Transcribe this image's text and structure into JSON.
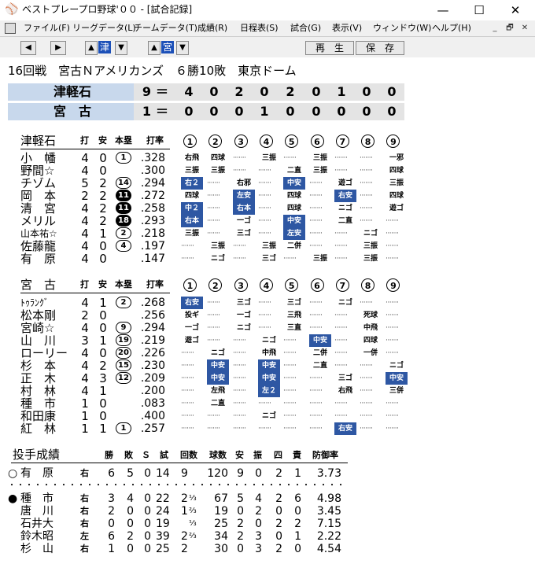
{
  "window": {
    "title": "ベストプレープロ野球'００ - [試合記録]",
    "controls": [
      "—",
      "☐",
      "✕"
    ]
  },
  "menu": {
    "items": [
      "ファイル(F)",
      "リーグデータ(L)",
      "チームデータ(T)",
      "成績(R)",
      "日程表(S)",
      "試合(G)",
      "表示(V)",
      "ウィンドウ(W)",
      "ヘルプ(H)"
    ],
    "mdi": [
      "_",
      "🗗",
      "✕"
    ]
  },
  "toolbar": {
    "left_arrow": "◀",
    "right_arrow": "▶",
    "team1": "津",
    "team2": "宮",
    "up": "▲",
    "down": "▼",
    "play_label": "再　生",
    "save_label": "保　存"
  },
  "game_info": "16回戦　宮古Ｎアメリカンズ　６勝10敗　東京ドーム",
  "scoreboard": [
    {
      "team": "津軽石",
      "total": "9",
      "eq": "＝",
      "innings": [
        "4",
        "0",
        "2",
        "0",
        "2",
        "0",
        "1",
        "0",
        "0"
      ]
    },
    {
      "team": "宮　古",
      "total": "1",
      "eq": "＝",
      "innings": [
        "0",
        "0",
        "0",
        "1",
        "0",
        "0",
        "0",
        "0",
        "0"
      ]
    }
  ],
  "batting_headers": {
    "ab": "打",
    "h": "安",
    "hr": "本塁",
    "avg": "打率",
    "innings": [
      "1",
      "2",
      "3",
      "4",
      "5",
      "6",
      "7",
      "8",
      "9"
    ]
  },
  "team1": {
    "name": "津軽石",
    "players": [
      {
        "name": "小　幡",
        "ab": "4",
        "h": "0",
        "hr": "1",
        "hr_filled": false,
        "avg": ".328",
        "cells": [
          {
            "t": "右飛"
          },
          {
            "t": "四球"
          },
          {
            "d": true
          },
          {
            "t": "三振"
          },
          {
            "d": true
          },
          {
            "t": "三振"
          },
          {
            "d": true
          },
          {
            "d": true
          },
          {
            "t": "一邪"
          }
        ]
      },
      {
        "name": "野間☆",
        "ab": "4",
        "h": "0",
        "hr": "",
        "hr_filled": false,
        "avg": ".300",
        "cells": [
          {
            "t": "三振"
          },
          {
            "t": "三振"
          },
          {
            "d": true
          },
          {
            "d": true
          },
          {
            "t": "二直"
          },
          {
            "t": "三振"
          },
          {
            "d": true
          },
          {
            "d": true
          },
          {
            "t": "四球"
          }
        ]
      },
      {
        "name": "チゾム",
        "ab": "5",
        "h": "2",
        "hr": "14",
        "hr_filled": false,
        "avg": ".294",
        "cells": [
          {
            "t": "右２",
            "hl": true
          },
          {
            "d": true
          },
          {
            "t": "右邪"
          },
          {
            "d": true
          },
          {
            "t": "中安",
            "hl": true
          },
          {
            "d": true
          },
          {
            "t": "遊ゴ"
          },
          {
            "d": true
          },
          {
            "t": "三振"
          }
        ]
      },
      {
        "name": "岡　本",
        "ab": "2",
        "h": "2",
        "hr": "11",
        "hr_filled": true,
        "avg": ".272",
        "cells": [
          {
            "t": "四球"
          },
          {
            "d": true
          },
          {
            "t": "左安",
            "hl": true
          },
          {
            "d": true
          },
          {
            "t": "四球"
          },
          {
            "d": true
          },
          {
            "t": "右安",
            "hl": true
          },
          {
            "d": true
          },
          {
            "t": "四球"
          }
        ]
      },
      {
        "name": "清　宮",
        "ab": "4",
        "h": "2",
        "hr": "11",
        "hr_filled": true,
        "avg": ".258",
        "cells": [
          {
            "t": "中２",
            "hl": true
          },
          {
            "d": true
          },
          {
            "t": "右本",
            "hl": true
          },
          {
            "d": true
          },
          {
            "t": "四球"
          },
          {
            "d": true
          },
          {
            "t": "ニゴ"
          },
          {
            "d": true
          },
          {
            "t": "遊ゴ"
          }
        ]
      },
      {
        "name": "メリル",
        "ab": "4",
        "h": "2",
        "hr": "18",
        "hr_filled": true,
        "avg": ".293",
        "cells": [
          {
            "t": "右本",
            "hl": true
          },
          {
            "d": true
          },
          {
            "t": "一ゴ"
          },
          {
            "d": true
          },
          {
            "t": "中安",
            "hl": true
          },
          {
            "d": true
          },
          {
            "t": "二直"
          },
          {
            "d": true
          },
          {
            "d": true
          }
        ]
      },
      {
        "name": "山本祐☆",
        "ab": "4",
        "h": "1",
        "hr": "2",
        "hr_filled": false,
        "avg": ".218",
        "small": true,
        "cells": [
          {
            "t": "三振"
          },
          {
            "d": true
          },
          {
            "t": "三ゴ"
          },
          {
            "d": true
          },
          {
            "t": "左安",
            "hl": true
          },
          {
            "d": true
          },
          {
            "d": true
          },
          {
            "t": "ニゴ"
          },
          {
            "d": true
          }
        ]
      },
      {
        "name": "佐藤龍",
        "ab": "4",
        "h": "0",
        "hr": "4",
        "hr_filled": false,
        "avg": ".197",
        "cells": [
          {
            "d": true
          },
          {
            "t": "三振"
          },
          {
            "d": true
          },
          {
            "t": "三振"
          },
          {
            "t": "二併"
          },
          {
            "d": true
          },
          {
            "d": true
          },
          {
            "t": "三振"
          },
          {
            "d": true
          }
        ]
      },
      {
        "name": "有　原",
        "ab": "4",
        "h": "0",
        "hr": "",
        "hr_filled": false,
        "avg": ".147",
        "cells": [
          {
            "d": true
          },
          {
            "t": "ニゴ"
          },
          {
            "d": true
          },
          {
            "t": "三ゴ"
          },
          {
            "d": true
          },
          {
            "t": "三振"
          },
          {
            "d": true
          },
          {
            "t": "三振"
          },
          {
            "d": true
          }
        ]
      }
    ]
  },
  "team2": {
    "name": "宮　古",
    "players": [
      {
        "name": "ﾄｩﾗﾝｸﾞ",
        "ab": "4",
        "h": "1",
        "hr": "2",
        "hr_filled": false,
        "avg": ".268",
        "small": true,
        "cells": [
          {
            "t": "右安",
            "hl": true
          },
          {
            "d": true
          },
          {
            "t": "三ゴ"
          },
          {
            "d": true
          },
          {
            "t": "三ゴ"
          },
          {
            "d": true
          },
          {
            "t": "ニゴ"
          },
          {
            "d": true
          },
          {
            "d": true
          }
        ]
      },
      {
        "name": "松本剛",
        "ab": "2",
        "h": "0",
        "hr": "",
        "hr_filled": false,
        "avg": ".256",
        "cells": [
          {
            "t": "投ギ"
          },
          {
            "d": true
          },
          {
            "t": "一ゴ"
          },
          {
            "d": true
          },
          {
            "t": "三飛"
          },
          {
            "d": true
          },
          {
            "d": true
          },
          {
            "t": "死球"
          },
          {
            "d": true
          }
        ]
      },
      {
        "name": "宮崎☆",
        "ab": "4",
        "h": "0",
        "hr": "9",
        "hr_filled": false,
        "avg": ".294",
        "cells": [
          {
            "t": "一ゴ"
          },
          {
            "d": true
          },
          {
            "t": "ニゴ"
          },
          {
            "d": true
          },
          {
            "t": "三直"
          },
          {
            "d": true
          },
          {
            "d": true
          },
          {
            "t": "中飛"
          },
          {
            "d": true
          }
        ]
      },
      {
        "name": "山　川",
        "ab": "3",
        "h": "1",
        "hr": "19",
        "hr_filled": false,
        "avg": ".219",
        "cells": [
          {
            "t": "遊ゴ"
          },
          {
            "d": true
          },
          {
            "d": true
          },
          {
            "t": "ニゴ"
          },
          {
            "d": true
          },
          {
            "t": "中安",
            "hl": true
          },
          {
            "d": true
          },
          {
            "t": "四球"
          },
          {
            "d": true
          }
        ]
      },
      {
        "name": "ローリー",
        "ab": "4",
        "h": "0",
        "hr": "20",
        "hr_filled": false,
        "avg": ".226",
        "cells": [
          {
            "d": true
          },
          {
            "t": "ニゴ"
          },
          {
            "d": true
          },
          {
            "t": "中飛"
          },
          {
            "d": true
          },
          {
            "t": "二併"
          },
          {
            "d": true
          },
          {
            "t": "一併"
          },
          {
            "d": true
          }
        ]
      },
      {
        "name": "杉　本",
        "ab": "4",
        "h": "2",
        "hr": "15",
        "hr_filled": false,
        "avg": ".230",
        "cells": [
          {
            "d": true
          },
          {
            "t": "中安",
            "hl": true
          },
          {
            "d": true
          },
          {
            "t": "中安",
            "hl": true
          },
          {
            "d": true
          },
          {
            "t": "二直"
          },
          {
            "d": true
          },
          {
            "d": true
          },
          {
            "t": "ニゴ"
          }
        ]
      },
      {
        "name": "正　木",
        "ab": "4",
        "h": "3",
        "hr": "12",
        "hr_filled": false,
        "avg": ".209",
        "cells": [
          {
            "d": true
          },
          {
            "t": "中安",
            "hl": true
          },
          {
            "d": true
          },
          {
            "t": "中安",
            "hl": true
          },
          {
            "d": true
          },
          {
            "d": true
          },
          {
            "t": "三ゴ"
          },
          {
            "d": true
          },
          {
            "t": "中安",
            "hl": true
          }
        ]
      },
      {
        "name": "村　林",
        "ab": "4",
        "h": "1",
        "hr": "",
        "hr_filled": false,
        "avg": ".200",
        "cells": [
          {
            "d": true
          },
          {
            "t": "左飛"
          },
          {
            "d": true
          },
          {
            "t": "左２",
            "hl": true
          },
          {
            "d": true
          },
          {
            "d": true
          },
          {
            "t": "右飛"
          },
          {
            "d": true
          },
          {
            "t": "三併"
          }
        ]
      },
      {
        "name": "種　市",
        "ab": "1",
        "h": "0",
        "hr": "",
        "hr_filled": false,
        "avg": ".083",
        "cells": [
          {
            "d": true
          },
          {
            "t": "二直"
          },
          {
            "d": true
          },
          {
            "d": true
          },
          {
            "d": true
          },
          {
            "d": true
          },
          {
            "d": true
          },
          {
            "d": true
          },
          {
            "d": true
          }
        ]
      },
      {
        "name": "和田康",
        "ab": "1",
        "h": "0",
        "hr": "",
        "hr_filled": false,
        "avg": ".400",
        "cells": [
          {
            "d": true
          },
          {
            "d": true
          },
          {
            "d": true
          },
          {
            "t": "ニゴ"
          },
          {
            "d": true
          },
          {
            "d": true
          },
          {
            "d": true
          },
          {
            "d": true
          },
          {
            "d": true
          }
        ]
      },
      {
        "name": "紅　林",
        "ab": "1",
        "h": "1",
        "hr": "1",
        "hr_filled": false,
        "avg": ".257",
        "cells": [
          {
            "d": true
          },
          {
            "d": true
          },
          {
            "d": true
          },
          {
            "d": true
          },
          {
            "d": true
          },
          {
            "d": true
          },
          {
            "t": "右安",
            "hl": true
          },
          {
            "d": true
          },
          {
            "d": true
          }
        ]
      }
    ]
  },
  "pitching": {
    "title": "投手成績",
    "headers": [
      "勝",
      "敗",
      "Ｓ",
      "試",
      "回数",
      "球数",
      "安",
      "振",
      "四",
      "責",
      "防御率"
    ],
    "separator": "・・・・・・・・・・・・・・・・・・・・・・・・・・・・・・・・・・・・・・・・・・・・・・・・・・・・・・",
    "team1": [
      {
        "mark": "○",
        "name": "有　原",
        "hand": "右",
        "w": "6",
        "l": "5",
        "s": "0",
        "g": "14",
        "ip": "9",
        "ipf": "",
        "pitches": "120",
        "h": "9",
        "k": "0",
        "bb": "2",
        "er": "1",
        "era": "3.73"
      }
    ],
    "team2": [
      {
        "mark": "●",
        "name": "種　市",
        "hand": "右",
        "w": "3",
        "l": "4",
        "s": "0",
        "g": "22",
        "ip": "2",
        "ipf": "⅓",
        "pitches": "67",
        "h": "5",
        "k": "4",
        "bb": "2",
        "er": "6",
        "era": "4.98"
      },
      {
        "mark": "",
        "name": "唐　川",
        "hand": "右",
        "w": "2",
        "l": "0",
        "s": "0",
        "g": "24",
        "ip": "1",
        "ipf": "⅔",
        "pitches": "19",
        "h": "0",
        "k": "2",
        "bb": "0",
        "er": "0",
        "era": "3.45"
      },
      {
        "mark": "",
        "name": "石井大",
        "hand": "右",
        "w": "0",
        "l": "0",
        "s": "0",
        "g": "19",
        "ip": "",
        "ipf": "⅓",
        "pitches": "25",
        "h": "2",
        "k": "0",
        "bb": "2",
        "er": "2",
        "era": "7.15"
      },
      {
        "mark": "",
        "name": "鈴木昭",
        "hand": "左",
        "w": "6",
        "l": "2",
        "s": "0",
        "g": "39",
        "ip": "2",
        "ipf": "⅔",
        "pitches": "34",
        "h": "2",
        "k": "3",
        "bb": "0",
        "er": "1",
        "era": "2.22"
      },
      {
        "mark": "",
        "name": "杉　山",
        "hand": "右",
        "w": "1",
        "l": "0",
        "s": "0",
        "g": "25",
        "ip": "2",
        "ipf": "",
        "pitches": "30",
        "h": "0",
        "k": "3",
        "bb": "2",
        "er": "0",
        "era": "4.54"
      }
    ]
  }
}
